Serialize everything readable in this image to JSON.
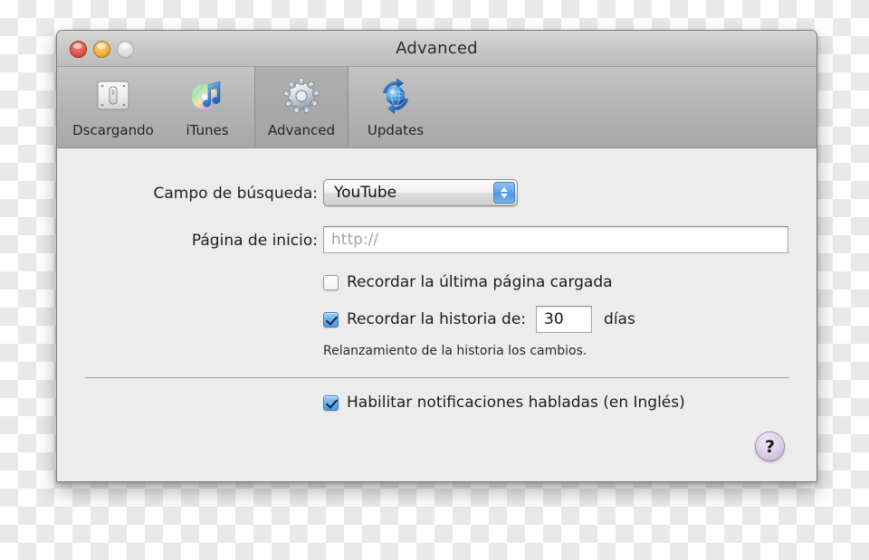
{
  "window": {
    "title": "Advanced",
    "traffic_lights": [
      {
        "name": "close",
        "color": "#e4574a"
      },
      {
        "name": "minimize",
        "color": "#f2b33f"
      },
      {
        "name": "zoom",
        "color": "#dedede",
        "disabled": true
      }
    ]
  },
  "toolbar": {
    "items": [
      {
        "label": "Dscargando",
        "icon": "download-switch-icon",
        "selected": false
      },
      {
        "label": "iTunes",
        "icon": "itunes-icon",
        "selected": false
      },
      {
        "label": "Advanced",
        "icon": "gear-icon",
        "selected": true
      },
      {
        "label": "Updates",
        "icon": "updates-globe-icon",
        "selected": false
      }
    ]
  },
  "form": {
    "search_field": {
      "label": "Campo de búsqueda:",
      "selected_option": "YouTube",
      "options": [
        "YouTube"
      ]
    },
    "home_page": {
      "label": "Página de inicio:",
      "value": "",
      "placeholder": "http://"
    },
    "remember_last_page": {
      "label": "Recordar la última página cargada",
      "checked": false
    },
    "remember_history": {
      "label": "Recordar la historia de:",
      "checked": true,
      "days_value": "30",
      "unit_label": "días"
    },
    "history_hint": "Relanzamiento de la historia los cambios.",
    "spoken_notifications": {
      "label": "Habilitar notificaciones habladas (en Inglés)",
      "checked": true
    }
  },
  "help_button": {
    "glyph": "?"
  }
}
